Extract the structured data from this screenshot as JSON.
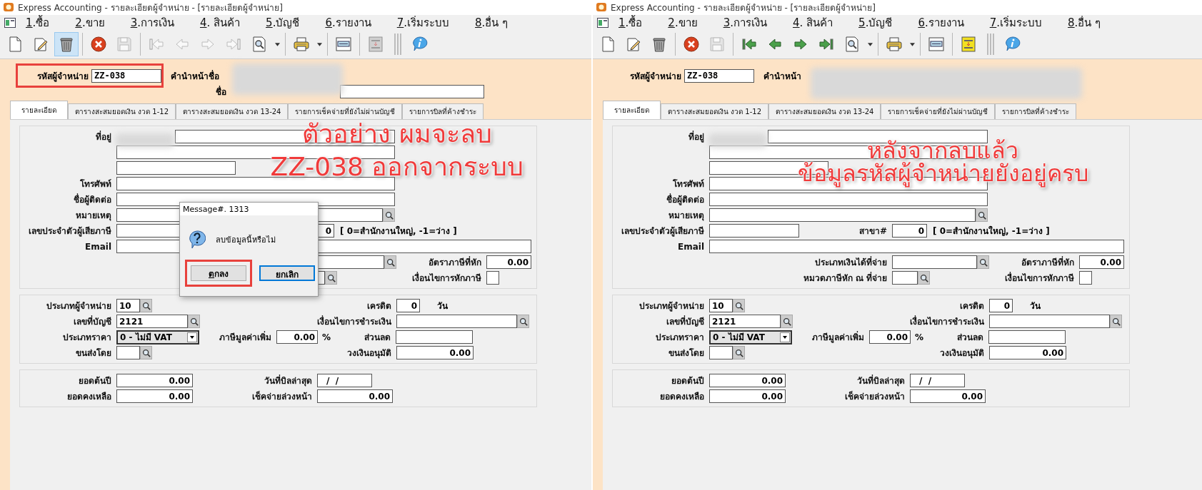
{
  "windows": [
    {
      "title": "Express Accounting - รายละเอียดผู้จำหน่าย - [รายละเอียดผู้จำหน่าย]",
      "menu": [
        {
          "key": "1",
          "label": ".ซื้อ"
        },
        {
          "key": "2",
          "label": ".ขาย"
        },
        {
          "key": "3",
          "label": ".การเงิน"
        },
        {
          "key": "4",
          "label": ". สินค้า"
        },
        {
          "key": "5",
          "label": ".บัญชี"
        },
        {
          "key": "6",
          "label": ".รายงาน"
        },
        {
          "key": "7",
          "label": ".เริ่มระบบ"
        },
        {
          "key": "8",
          "label": ".อื่น ๆ"
        }
      ],
      "toolbar": [
        {
          "kind": "new",
          "disabled": false,
          "pressed": false
        },
        {
          "kind": "edit",
          "disabled": false,
          "pressed": false
        },
        {
          "kind": "delete",
          "disabled": false,
          "pressed": true
        },
        {
          "kind": "separator"
        },
        {
          "kind": "cancel",
          "disabled": false,
          "pressed": false
        },
        {
          "kind": "save",
          "disabled": true,
          "pressed": false
        },
        {
          "kind": "separator"
        },
        {
          "kind": "first",
          "disabled": true,
          "pressed": false
        },
        {
          "kind": "prev",
          "disabled": true,
          "pressed": false
        },
        {
          "kind": "next",
          "disabled": true,
          "pressed": false
        },
        {
          "kind": "last",
          "disabled": true,
          "pressed": false
        },
        {
          "kind": "search",
          "disabled": false,
          "pressed": false
        },
        {
          "kind": "dropdown",
          "disabled": false,
          "pressed": false
        },
        {
          "kind": "separator"
        },
        {
          "kind": "print",
          "disabled": false,
          "pressed": false
        },
        {
          "kind": "dropdown",
          "disabled": false,
          "pressed": false
        },
        {
          "kind": "separator"
        },
        {
          "kind": "note",
          "disabled": false,
          "pressed": false
        },
        {
          "kind": "separator"
        },
        {
          "kind": "old-new",
          "disabled": true,
          "pressed": false
        },
        {
          "kind": "grip"
        },
        {
          "kind": "info",
          "disabled": false,
          "pressed": false
        }
      ],
      "header": {
        "code_label": "รหัสผู้จำหน่าย",
        "code": "ZZ-038",
        "prefix_label": "คำนำหน้าชื่อ",
        "name_label": "ชื่อ",
        "highlighted": true
      },
      "tabs": [
        {
          "label": "รายละเอียด",
          "selected": true
        },
        {
          "label": "ตารางสะสมยอดเงิน งวด  1-12",
          "selected": false
        },
        {
          "label": "ตารางสะสมยอดเงิน งวด 13-24",
          "selected": false
        },
        {
          "label": "รายการเช็คจ่ายที่ยังไม่ผ่านบัญชี",
          "selected": false
        },
        {
          "label": "รายการบิลที่ค้างชำระ",
          "selected": false
        }
      ],
      "form": {
        "address_label": "ที่อยู่",
        "phone_label": "โทรศัพท์",
        "contact_label": "ชื่อผู้ติดต่อ",
        "note_label": "หมายเหตุ",
        "taxid_label": "เลขประจำตัวผู้เสียภาษี",
        "branch": "0",
        "branch_note": "[ 0=สำนักงานใหญ่, -1=ว่าง ]",
        "email_label": "Email",
        "wht_rate_label": "อัตราภาษีที่หัก",
        "wht_rate": "0.00",
        "wht_condition_label": "เงื่อนไขการหักภาษี",
        "wht_condition_checked": false,
        "supplier_type_label": "ประเภทผู้จำหน่าย",
        "supplier_type": "10",
        "credit_label": "เครดิต",
        "credit": "0",
        "credit_unit": "วัน",
        "account_label": "เลขที่บัญชี",
        "account": "2121",
        "payment_terms_label": "เงื่อนไขการชำระเงิน",
        "price_type_label": "ประเภทราคา",
        "price_type": "0 - ไม่มี VAT",
        "vat_label": "ภาษีมูลค่าเพิ่ม",
        "vat": "0.00",
        "vat_unit": "%",
        "discount_label": "ส่วนลด",
        "shipping_label": "ขนส่งโดย",
        "credit_limit_label": "วงเงินอนุมัติ",
        "credit_limit": "0.00",
        "opening_label": "ยอดต้นปี",
        "opening": "0.00",
        "last_bill_label": "วันที่บิลล่าสุด",
        "last_bill": "/  /",
        "balance_label": "ยอดคงเหลือ",
        "balance": "0.00",
        "advance_label": "เช็คจ่ายล่วงหน้า",
        "advance": "0.00"
      },
      "annotation": [
        "ตัวอย่าง ผมจะลบ",
        "ZZ-038 ออกจากระบบ"
      ],
      "dialog": {
        "title": "Message#. 1313",
        "message": "ลบข้อมูลนี้หรือไม่",
        "buttons": [
          {
            "accel": "ต",
            "label": "กลง",
            "default": false,
            "highlighted": true
          },
          {
            "label": "ยกเลิก",
            "default": true,
            "highlighted": false
          }
        ]
      }
    },
    {
      "title": "Express Accounting - รายละเอียดผู้จำหน่าย - [รายละเอียดผู้จำหน่าย]",
      "menu": [
        {
          "key": "1",
          "label": ".ซื้อ"
        },
        {
          "key": "2",
          "label": ".ขาย"
        },
        {
          "key": "3",
          "label": ".การเงิน"
        },
        {
          "key": "4",
          "label": ". สินค้า"
        },
        {
          "key": "5",
          "label": ".บัญชี"
        },
        {
          "key": "6",
          "label": ".รายงาน"
        },
        {
          "key": "7",
          "label": ".เริ่มระบบ"
        },
        {
          "key": "8",
          "label": ".อื่น ๆ"
        }
      ],
      "toolbar": [
        {
          "kind": "new",
          "disabled": false,
          "pressed": false
        },
        {
          "kind": "edit",
          "disabled": false,
          "pressed": false
        },
        {
          "kind": "delete",
          "disabled": false,
          "pressed": false
        },
        {
          "kind": "separator"
        },
        {
          "kind": "cancel",
          "disabled": false,
          "pressed": false
        },
        {
          "kind": "save",
          "disabled": true,
          "pressed": false
        },
        {
          "kind": "separator"
        },
        {
          "kind": "first",
          "disabled": false,
          "pressed": false
        },
        {
          "kind": "prev",
          "disabled": false,
          "pressed": false
        },
        {
          "kind": "next",
          "disabled": false,
          "pressed": false
        },
        {
          "kind": "last",
          "disabled": false,
          "pressed": false
        },
        {
          "kind": "search",
          "disabled": false,
          "pressed": false
        },
        {
          "kind": "dropdown",
          "disabled": false,
          "pressed": false
        },
        {
          "kind": "separator"
        },
        {
          "kind": "print",
          "disabled": false,
          "pressed": false
        },
        {
          "kind": "dropdown",
          "disabled": false,
          "pressed": false
        },
        {
          "kind": "separator"
        },
        {
          "kind": "note",
          "disabled": false,
          "pressed": false
        },
        {
          "kind": "separator"
        },
        {
          "kind": "old-new",
          "disabled": false,
          "pressed": false
        },
        {
          "kind": "grip"
        },
        {
          "kind": "info",
          "disabled": false,
          "pressed": false
        }
      ],
      "header": {
        "code_label": "รหัสผู้จำหน่าย",
        "code": "ZZ-038",
        "prefix_label": "คำนำหน้า",
        "highlighted": false
      },
      "tabs": [
        {
          "label": "รายละเอียด",
          "selected": true
        },
        {
          "label": "ตารางสะสมยอดเงิน งวด  1-12",
          "selected": false
        },
        {
          "label": "ตารางสะสมยอดเงิน งวด 13-24",
          "selected": false
        },
        {
          "label": "รายการเช็คจ่ายที่ยังไม่ผ่านบัญชี",
          "selected": false
        },
        {
          "label": "รายการบิลที่ค้างชำระ",
          "selected": false
        }
      ],
      "form": {
        "address_label": "ที่อยู่",
        "phone_label": "โทรศัพท์",
        "contact_label": "ชื่อผู้ติดต่อ",
        "note_label": "หมายเหตุ",
        "taxid_label": "เลขประจำตัวผู้เสียภาษี",
        "branch_label": "สาขา#",
        "branch": "0",
        "branch_note": "[ 0=สำนักงานใหญ่, -1=ว่าง ]",
        "email_label": "Email",
        "income_type_label": "ประเภทเงินได้ที่จ่าย",
        "wht_rate_label": "อัตราภาษีที่หัก",
        "wht_rate": "0.00",
        "wht_category_label": "หมวดภาษีหัก ณ ที่จ่าย",
        "wht_condition_label": "เงื่อนไขการหักภาษี",
        "wht_condition_checked": false,
        "supplier_type_label": "ประเภทผู้จำหน่าย",
        "supplier_type": "10",
        "credit_label": "เครดิต",
        "credit": "0",
        "credit_unit": "วัน",
        "account_label": "เลขที่บัญชี",
        "account": "2121",
        "payment_terms_label": "เงื่อนไขการชำระเงิน",
        "price_type_label": "ประเภทราคา",
        "price_type": "0 - ไม่มี VAT",
        "vat_label": "ภาษีมูลค่าเพิ่ม",
        "vat": "0.00",
        "vat_unit": "%",
        "discount_label": "ส่วนลด",
        "shipping_label": "ขนส่งโดย",
        "credit_limit_label": "วงเงินอนุมัติ",
        "credit_limit": "0.00",
        "opening_label": "ยอดต้นปี",
        "opening": "0.00",
        "last_bill_label": "วันที่บิลล่าสุด",
        "last_bill": "/  /",
        "balance_label": "ยอดคงเหลือ",
        "balance": "0.00",
        "advance_label": "เช็คจ่ายล่วงหน้า",
        "advance": "0.00"
      },
      "annotation": [
        "หลังจากลบแล้ว",
        "ข้อมูลรหัสผู้จำหน่ายยังอยู่ครบ"
      ]
    }
  ]
}
